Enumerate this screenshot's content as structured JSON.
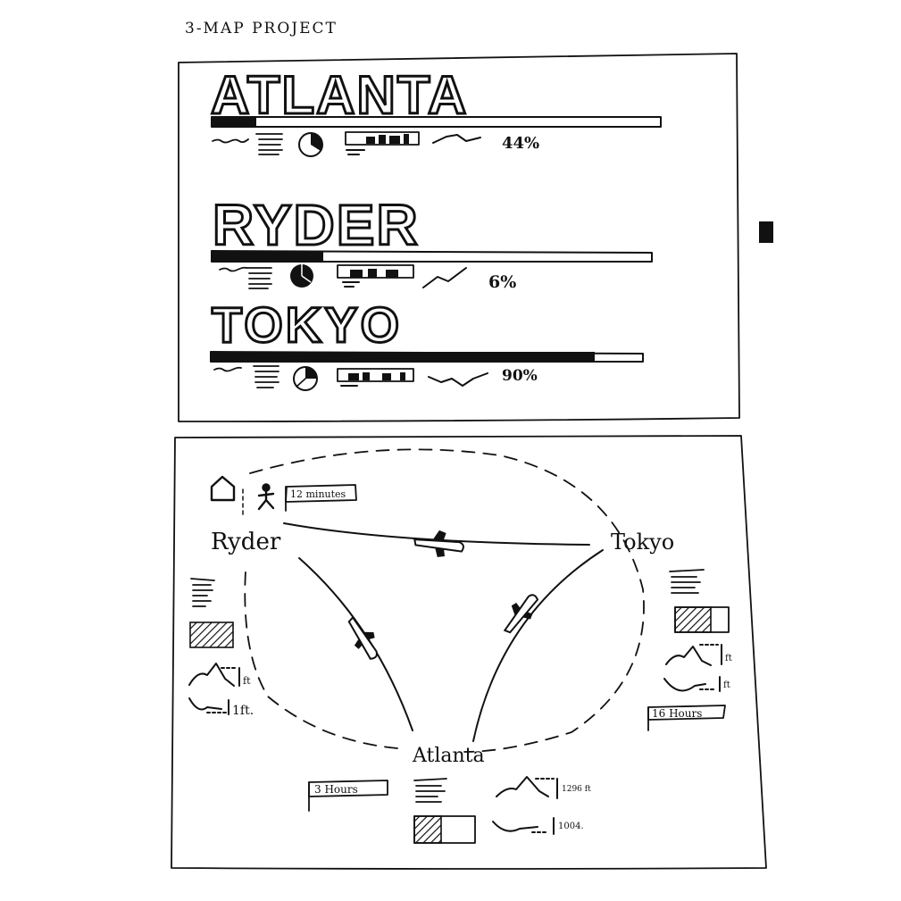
{
  "project_title": "3-MAP PROJECT",
  "colors": {
    "ink": "#111111",
    "paper": "#ffffff"
  },
  "overview": {
    "cities": [
      {
        "name": "ATLANTA",
        "percent": "44%",
        "bar_fill": 0.1
      },
      {
        "name": "RYDER",
        "percent": "6%",
        "bar_fill": 0.25
      },
      {
        "name": "TOKYO",
        "percent": "90%",
        "bar_fill": 0.88
      }
    ],
    "row_icons": [
      "squiggle-icon",
      "text-lines-icon",
      "pie-icon",
      "bar-strip-icon",
      "trend-line-icon"
    ]
  },
  "map": {
    "legend_time": "12 minutes",
    "nodes": {
      "ryder": "Ryder",
      "tokyo": "Tokyo",
      "atlanta": "Atlanta"
    },
    "ryder_panel": {
      "elevation_unit": "ft",
      "depth_label": "1ft."
    },
    "tokyo_panel": {
      "duration": "16 Hours",
      "elevation_unit": "ft",
      "depth_unit": "ft"
    },
    "atlanta_panel": {
      "duration": "3 Hours",
      "elevation": "1296 ft",
      "depth": "1004."
    },
    "route_icons": [
      "airplane-icon",
      "airplane-icon",
      "airplane-icon"
    ]
  }
}
